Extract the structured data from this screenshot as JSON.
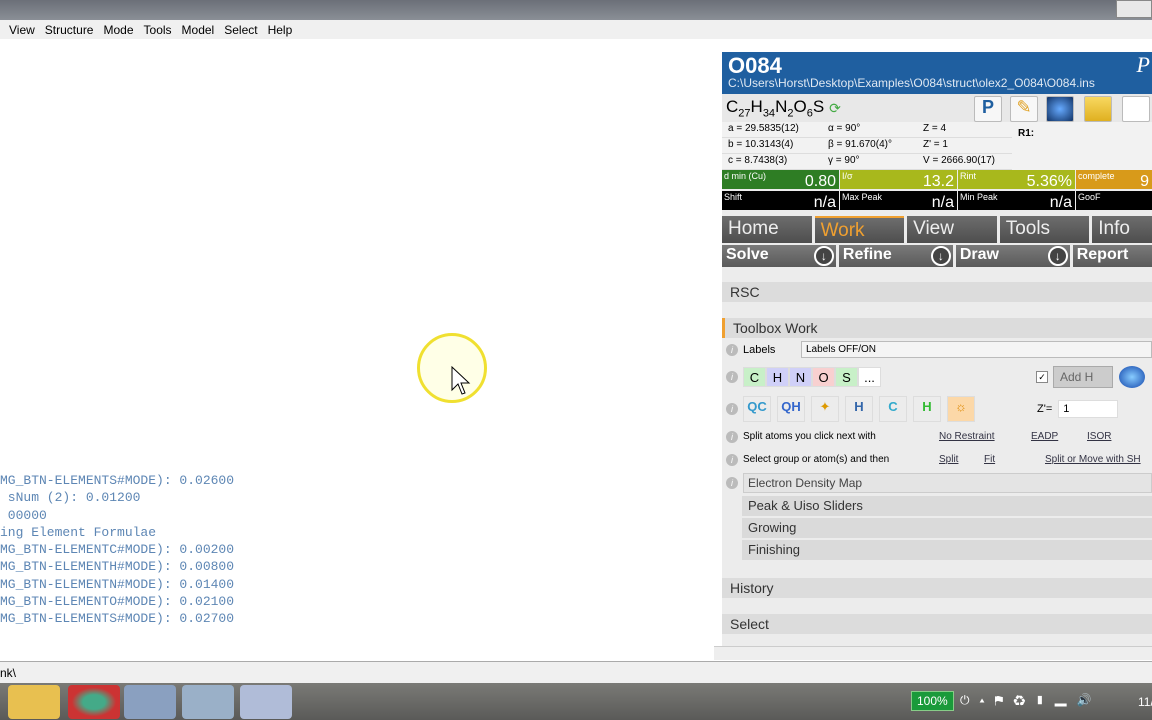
{
  "menu": [
    "View",
    "Structure",
    "Mode",
    "Tools",
    "Model",
    "Select",
    "Help"
  ],
  "console_lines": [
    "MG_BTN-ELEMENTS#MODE): 0.02600",
    " sNum (2): 0.01200",
    " 00000",
    "ing Element Formulae",
    "MG_BTN-ELEMENTC#MODE): 0.00200",
    "MG_BTN-ELEMENTH#MODE): 0.00800",
    "MG_BTN-ELEMENTN#MODE): 0.01400",
    "MG_BTN-ELEMENTO#MODE): 0.02100",
    "MG_BTN-ELEMENTS#MODE): 0.02700"
  ],
  "status_text": "nk\\",
  "header": {
    "title": "O084",
    "path": "C:\\Users\\Horst\\Desktop\\Examples\\O084\\struct\\olex2_O084\\O084.ins",
    "corner": "P"
  },
  "formula": {
    "parts": [
      "C",
      "27",
      "H",
      "34",
      "N",
      "2",
      "O",
      "6",
      "S"
    ]
  },
  "cell": {
    "a": "a = 29.5835(12)",
    "b": "b = 10.3143(4)",
    "c": "c = 8.7438(3)",
    "alpha": "α = 90°",
    "beta": "β = 91.670(4)°",
    "gamma": "γ = 90°",
    "Z": "Z = 4",
    "Zp": "Z' = 1",
    "V": "V = 2666.90(17)",
    "r1": "R1:"
  },
  "stats": [
    {
      "label": "d min (Cu)",
      "value": "0.80",
      "color": "#2e7d24"
    },
    {
      "label": "I/σ",
      "value": "13.2",
      "color": "#a8b81c"
    },
    {
      "label": "Rint",
      "value": "5.36%",
      "color": "#a8b81c"
    },
    {
      "label": "complete",
      "value": "9",
      "color": "#d89a1a"
    },
    {
      "label": "Shift",
      "value": "n/a",
      "color": "#000000"
    },
    {
      "label": "Max Peak",
      "value": "n/a",
      "color": "#000000"
    },
    {
      "label": "Min Peak",
      "value": "n/a",
      "color": "#000000"
    },
    {
      "label": "GooF",
      "value": "",
      "color": "#000000"
    }
  ],
  "tabs": [
    "Home",
    "Work",
    "View",
    "Tools",
    "Info"
  ],
  "subtabs": [
    "Solve",
    "Refine",
    "Draw",
    "Report"
  ],
  "sections": {
    "rsc": "RSC",
    "toolbox": "Toolbox Work",
    "history": "History",
    "select": "Select"
  },
  "toolbox": {
    "labels_label": "Labels",
    "labels_value": "Labels OFF/ON",
    "elements": [
      "C",
      "H",
      "N",
      "O",
      "S",
      "..."
    ],
    "addh": "Add H",
    "zprime_label": "Z'=",
    "zprime_value": "1",
    "split_text": "Split atoms you click next with",
    "split_links": [
      "No Restraint",
      "EADP",
      "ISOR"
    ],
    "select_text": "Select group or atom(s) and then",
    "select_links": [
      "Split",
      "Fit",
      "Split or Move with SH"
    ],
    "edm": "Electron Density Map",
    "groups": [
      "Peak & Uiso Sliders",
      "Growing",
      "Finishing"
    ]
  },
  "tray": {
    "battery": "100%",
    "clock": "11/"
  }
}
